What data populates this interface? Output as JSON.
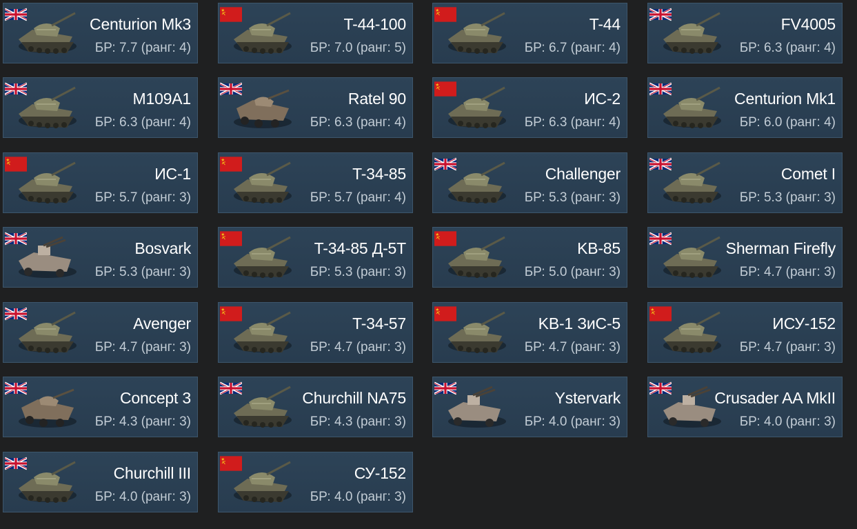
{
  "flags": {
    "uk": "uk-flag-icon",
    "ussr": "ussr-flag-icon"
  },
  "colors": {
    "background": "#1f2021",
    "card": "#2b4054",
    "card_border": "#3d566c",
    "name_text": "#ffffff",
    "br_text": "#c2ccd5",
    "ussr_red": "#d11c1c",
    "uk_blue": "#0b2a78"
  },
  "vehicles": [
    {
      "name": "Centurion Mk3",
      "br": "БР: 7.7 (ранг: 4)",
      "nation": "uk",
      "icon": "tank-icon"
    },
    {
      "name": "T-44-100",
      "br": "БР: 7.0 (ранг: 5)",
      "nation": "ussr",
      "icon": "tank-icon"
    },
    {
      "name": "T-44",
      "br": "БР: 6.7 (ранг: 4)",
      "nation": "ussr",
      "icon": "tank-icon"
    },
    {
      "name": "FV4005",
      "br": "БР: 6.3 (ранг: 4)",
      "nation": "uk",
      "icon": "tank-destroyer-icon"
    },
    {
      "name": "M109A1",
      "br": "БР: 6.3 (ранг: 4)",
      "nation": "uk",
      "icon": "self-propelled-gun-icon"
    },
    {
      "name": "Ratel 90",
      "br": "БР: 6.3 (ранг: 4)",
      "nation": "uk",
      "icon": "wheeled-vehicle-icon"
    },
    {
      "name": "ИС-2",
      "br": "БР: 6.3 (ранг: 4)",
      "nation": "ussr",
      "icon": "tank-icon"
    },
    {
      "name": "Centurion Mk1",
      "br": "БР: 6.0 (ранг: 4)",
      "nation": "uk",
      "icon": "tank-icon"
    },
    {
      "name": "ИС-1",
      "br": "БР: 5.7 (ранг: 3)",
      "nation": "ussr",
      "icon": "tank-icon"
    },
    {
      "name": "T-34-85",
      "br": "БР: 5.7 (ранг: 4)",
      "nation": "ussr",
      "icon": "tank-icon"
    },
    {
      "name": "Challenger",
      "br": "БР: 5.3 (ранг: 3)",
      "nation": "uk",
      "icon": "tank-icon"
    },
    {
      "name": "Comet I",
      "br": "БР: 5.3 (ранг: 3)",
      "nation": "uk",
      "icon": "tank-icon"
    },
    {
      "name": "Bosvark",
      "br": "БР: 5.3 (ранг: 3)",
      "nation": "uk",
      "icon": "anti-air-vehicle-icon"
    },
    {
      "name": "T-34-85 Д-5T",
      "br": "БР: 5.3 (ранг: 3)",
      "nation": "ussr",
      "icon": "tank-icon"
    },
    {
      "name": "KB-85",
      "br": "БР: 5.0 (ранг: 3)",
      "nation": "ussr",
      "icon": "tank-icon"
    },
    {
      "name": "Sherman Firefly",
      "br": "БР: 4.7 (ранг: 3)",
      "nation": "uk",
      "icon": "tank-icon"
    },
    {
      "name": "Avenger",
      "br": "БР: 4.7 (ранг: 3)",
      "nation": "uk",
      "icon": "tank-icon"
    },
    {
      "name": "T-34-57",
      "br": "БР: 4.7 (ранг: 3)",
      "nation": "ussr",
      "icon": "tank-icon"
    },
    {
      "name": "KB-1 ЗиС-5",
      "br": "БР: 4.7 (ранг: 3)",
      "nation": "ussr",
      "icon": "tank-icon"
    },
    {
      "name": "ИСУ-152",
      "br": "БР: 4.7 (ранг: 3)",
      "nation": "ussr",
      "icon": "tank-destroyer-icon"
    },
    {
      "name": "Concept 3",
      "br": "БР: 4.3 (ранг: 3)",
      "nation": "uk",
      "icon": "wheeled-vehicle-icon"
    },
    {
      "name": "Churchill NA75",
      "br": "БР: 4.3 (ранг: 3)",
      "nation": "uk",
      "icon": "tank-icon"
    },
    {
      "name": "Ystervark",
      "br": "БР: 4.0 (ранг: 3)",
      "nation": "uk",
      "icon": "anti-air-vehicle-icon"
    },
    {
      "name": "Crusader AA MkII",
      "br": "БР: 4.0 (ранг: 3)",
      "nation": "uk",
      "icon": "anti-air-vehicle-icon"
    },
    {
      "name": "Churchill III",
      "br": "БР: 4.0 (ранг: 3)",
      "nation": "uk",
      "icon": "tank-icon"
    },
    {
      "name": "СУ-152",
      "br": "БР: 4.0 (ранг: 3)",
      "nation": "ussr",
      "icon": "tank-destroyer-icon"
    }
  ]
}
